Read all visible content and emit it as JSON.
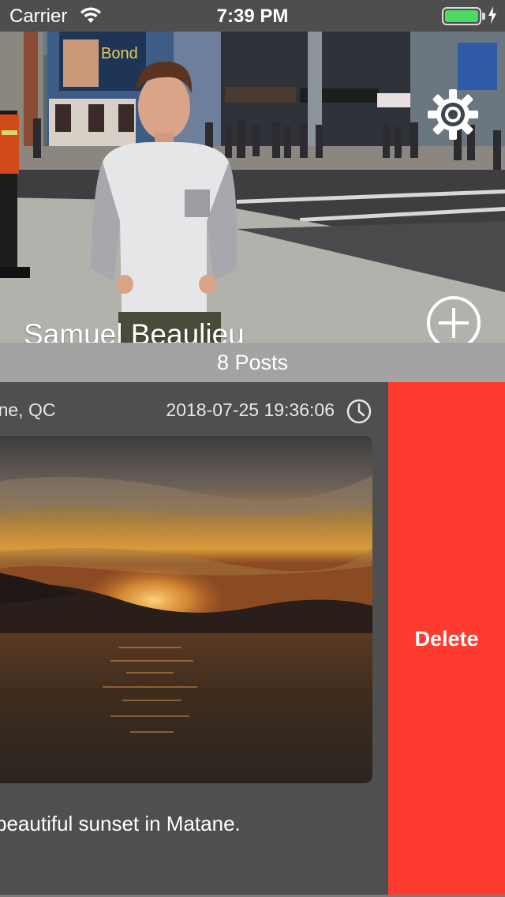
{
  "status_bar": {
    "carrier": "Carrier",
    "time": "7:39 PM",
    "battery_color": "#4cd964"
  },
  "profile": {
    "name": "Samuel Beaulieu",
    "settings_icon": "gear-icon",
    "add_icon": "plus-circle-icon"
  },
  "posts": {
    "count_label": "8 Posts"
  },
  "post": {
    "location": "onne, QC",
    "date": "2018-07-25 19:36:06",
    "caption": "beautiful sunset in Matane.",
    "clock_icon": "clock-icon"
  },
  "swipe_actions": {
    "delete_label": "Delete",
    "delete_color": "#ff3b30"
  }
}
